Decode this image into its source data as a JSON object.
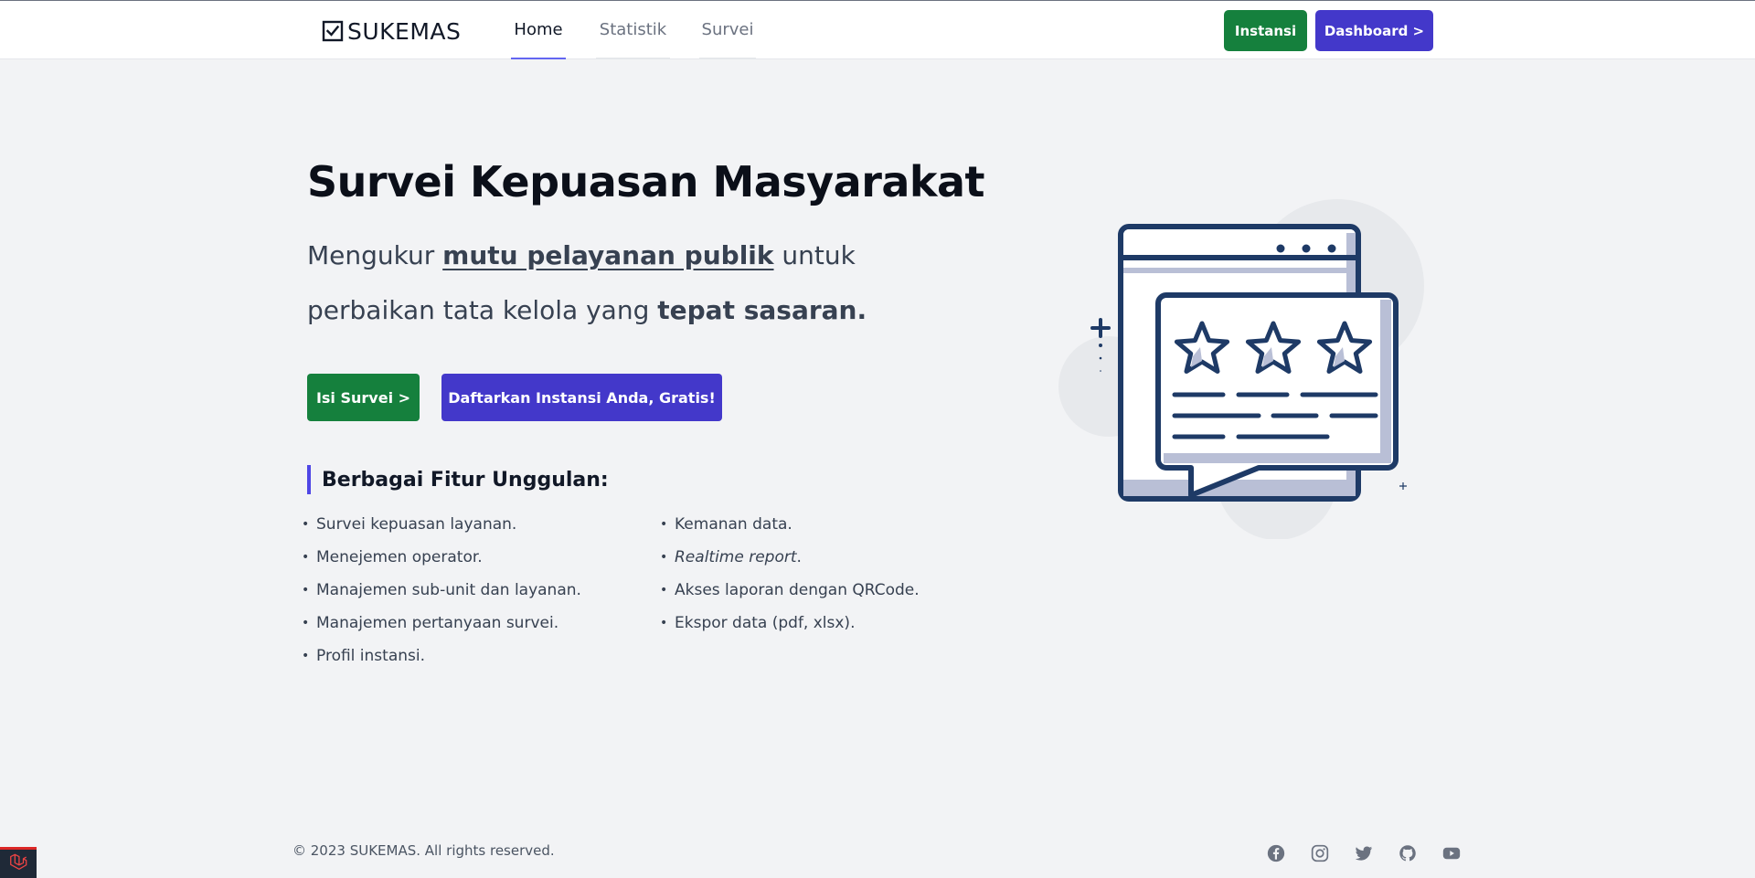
{
  "navbar": {
    "brand": "SUKEMAS",
    "tabs": [
      {
        "label": "Home",
        "active": true
      },
      {
        "label": "Statistik",
        "active": false
      },
      {
        "label": "Survei",
        "active": false
      }
    ],
    "buttons": {
      "instansi": "Instansi",
      "dashboard": "Dashboard >"
    }
  },
  "hero": {
    "title": "Survei Kepuasan Masyarakat",
    "subtitle_part1": "Mengukur ",
    "subtitle_highlight": "mutu pelayanan publik",
    "subtitle_part2": " untuk perbaikan tata kelola yang ",
    "subtitle_bold": "tepat sasaran.",
    "cta_primary": "Isi Survei >",
    "cta_secondary": "Daftarkan Instansi Anda, Gratis!"
  },
  "features": {
    "heading": "Berbagai Fitur Unggulan:",
    "left": [
      "Survei kepuasan layanan.",
      "Menejemen operator.",
      "Manajemen sub-unit dan layanan.",
      "Manajemen pertanyaan survei.",
      "Profil instansi."
    ],
    "right_1": "Kemanan data.",
    "right_2_italic": "Realtime report",
    "right_2_tail": ".",
    "right_3": "Akses laporan dengan QRCode.",
    "right_4": "Ekspor data (pdf, xlsx)."
  },
  "footer": {
    "copyright": "© 2023 SUKEMAS. All rights reserved.",
    "social_icons": [
      "facebook-icon",
      "instagram-icon",
      "twitter-icon",
      "github-icon",
      "youtube-icon"
    ]
  },
  "colors": {
    "accent_indigo": "#4338ca",
    "accent_green": "#15803d",
    "illustration_navy": "#1e3a66",
    "illustration_lavender": "#b9bfd6"
  }
}
